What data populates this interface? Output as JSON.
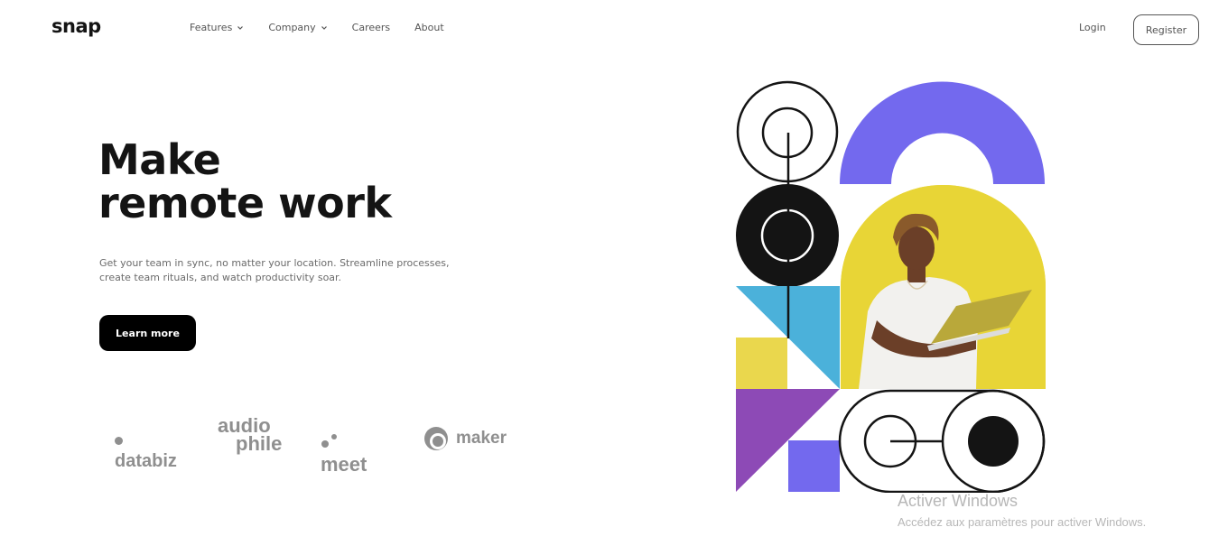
{
  "brand": {
    "logo": "snap"
  },
  "nav": {
    "items": [
      {
        "label": "Features",
        "dropdown": true
      },
      {
        "label": "Company",
        "dropdown": true
      },
      {
        "label": "Careers",
        "dropdown": false
      },
      {
        "label": "About",
        "dropdown": false
      }
    ],
    "login": "Login",
    "register": "Register"
  },
  "hero": {
    "title_line1": "Make",
    "title_line2": "remote work",
    "description": "Get your team in sync, no matter your location. Streamline processes, create team rituals, and watch productivity soar.",
    "cta": "Learn more"
  },
  "clients": {
    "databiz": "databiz",
    "audiophile_top": "audio",
    "audiophile_bottom": "phile",
    "meet": "meet",
    "maker": "maker"
  },
  "colors": {
    "purple": "#7369ee",
    "blue": "#4bb1da",
    "yellow": "#ead74d",
    "violet": "#8d4ab6",
    "dark": "#141414",
    "photo_bg": "#e8d536"
  },
  "watermark": {
    "title": "Activer Windows",
    "subtitle": "Accédez aux paramètres pour activer Windows."
  }
}
